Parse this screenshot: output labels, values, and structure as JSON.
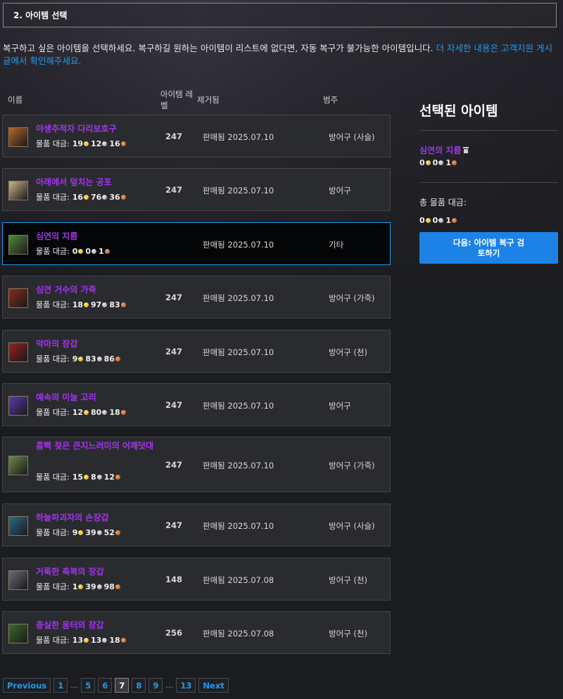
{
  "header": {
    "step_title": "2. 아이템 선택"
  },
  "intro": {
    "text": "복구하고 싶은 아이템을 선택하세요. 복구하길 원하는 아이템이 리스트에 없다면, 자동 복구가 불가능한 아이템입니다. ",
    "link": "더 자세한 내용은 고객지원 게시글에서 확인해주세요."
  },
  "table": {
    "headers": {
      "name": "이름",
      "level": "아이템 레벨",
      "removed": "제거됨",
      "category": "범주"
    },
    "cost_label": "물품 대금:",
    "items": [
      {
        "name": "야생추적자 다리보호구",
        "gold": "19",
        "silver": "12",
        "copper": "16",
        "level": "247",
        "removed": "판매됨 2025.07.10",
        "category": "방어구 (사슬)",
        "icon": "leg-armor-icon",
        "icon_color": "#b5652a"
      },
      {
        "name": "아래에서 덮치는 공포",
        "gold": "16",
        "silver": "76",
        "copper": "36",
        "level": "247",
        "removed": "판매됨 2025.07.10",
        "category": "방어구",
        "icon": "jaws-icon",
        "icon_color": "#c9b48a"
      },
      {
        "name": "심연의 지름",
        "gold": "0",
        "silver": "0",
        "copper": "1",
        "level": "",
        "removed": "판매됨 2025.07.10",
        "category": "기타",
        "icon": "green-scale-icon",
        "icon_color": "#4f8a3a",
        "selected": true
      },
      {
        "name": "심연 거수의 가죽",
        "gold": "18",
        "silver": "97",
        "copper": "83",
        "level": "247",
        "removed": "판매됨 2025.07.10",
        "category": "방어구 (가죽)",
        "icon": "dark-hide-icon",
        "icon_color": "#8a2a1a"
      },
      {
        "name": "악마의 장갑",
        "gold": "9",
        "silver": "83",
        "copper": "86",
        "level": "247",
        "removed": "판매됨 2025.07.10",
        "category": "방어구 (천)",
        "icon": "crimson-glove-icon",
        "icon_color": "#9a1f1f"
      },
      {
        "name": "예속의 미늘 고리",
        "gold": "12",
        "silver": "80",
        "copper": "18",
        "level": "247",
        "removed": "판매됨 2025.07.10",
        "category": "방어구",
        "icon": "barbed-ring-icon",
        "icon_color": "#5a3ab0"
      },
      {
        "name": "흠뻑 젖은 큰지느러미의 어깨덧대",
        "gold": "15",
        "silver": "8",
        "copper": "12",
        "level": "247",
        "removed": "판매됨 2025.07.10",
        "category": "방어구 (가죽)",
        "icon": "shoulder-pad-icon",
        "icon_color": "#6a8a4a"
      },
      {
        "name": "하늘파괴자의 손장갑",
        "gold": "9",
        "silver": "39",
        "copper": "52",
        "level": "247",
        "removed": "판매됨 2025.07.10",
        "category": "방어구 (사슬)",
        "icon": "sky-gauntlet-icon",
        "icon_color": "#2a6a8a"
      },
      {
        "name": "거룩한 축복의 장갑",
        "gold": "1",
        "silver": "39",
        "copper": "98",
        "level": "148",
        "removed": "판매됨 2025.07.08",
        "category": "방어구 (천)",
        "icon": "holy-glove-icon",
        "icon_color": "#6a6a7a"
      },
      {
        "name": "충실한 움터의 장갑",
        "gold": "13",
        "silver": "13",
        "copper": "18",
        "level": "256",
        "removed": "판매됨 2025.07.08",
        "category": "방어구 (천)",
        "icon": "faithful-glove-icon",
        "icon_color": "#3a6a2a"
      }
    ]
  },
  "sidebar": {
    "title": "선택된 아이템",
    "selected_item": {
      "name": "심연의 지름",
      "gold": "0",
      "silver": "0",
      "copper": "1"
    },
    "total_label": "총 물품 대금:",
    "total": {
      "gold": "0",
      "silver": "0",
      "copper": "1"
    },
    "next_button": "다음: 아이템 복구 검토하기"
  },
  "pagination": {
    "previous": "Previous",
    "next": "Next",
    "pages": [
      "1",
      "…",
      "5",
      "6",
      "7",
      "8",
      "9",
      "…",
      "13"
    ],
    "current": "7"
  }
}
